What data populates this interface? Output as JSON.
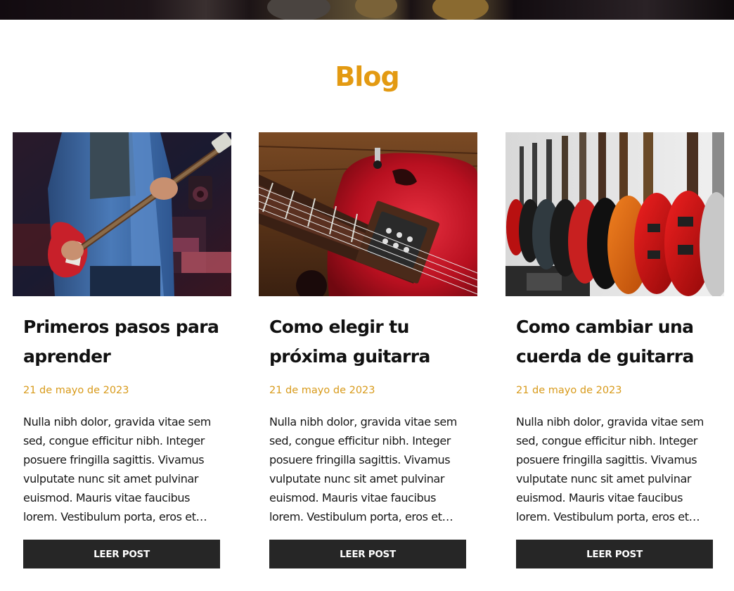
{
  "section": {
    "title": "Blog"
  },
  "posts": [
    {
      "title": "Primeros pasos para aprender",
      "date": "21 de mayo de 2023",
      "excerpt": "Nulla nibh dolor, gravida vitae sem sed, congue efficitur nibh. Integer posuere fringilla sagittis. Vivamus vulputate nunc sit amet pulvinar euismod. Mauris vitae faucibus lorem. Vestibulum porta, eros et…",
      "button_label": "LEER POST",
      "image_alt": "guitarist-playing-red-electric-guitar"
    },
    {
      "title": "Como elegir tu próxima guitarra",
      "date": "21 de mayo de 2023",
      "excerpt": "Nulla nibh dolor, gravida vitae sem sed, congue efficitur nibh. Integer posuere fringilla sagittis. Vivamus vulputate nunc sit amet pulvinar euismod. Mauris vitae faucibus lorem. Vestibulum porta, eros et…",
      "button_label": "LEER POST",
      "image_alt": "red-guitar-body-on-wood"
    },
    {
      "title": "Como cambiar una cuerda de guitarra",
      "date": "21 de mayo de 2023",
      "excerpt": "Nulla nibh dolor, gravida vitae sem sed, congue efficitur nibh. Integer posuere fringilla sagittis. Vivamus vulputate nunc sit amet pulvinar euismod. Mauris vitae faucibus lorem. Vestibulum porta, eros et…",
      "button_label": "LEER POST",
      "image_alt": "guitars-hanging-in-store"
    }
  ],
  "colors": {
    "accent": "#e39a12",
    "date": "#d89a1a",
    "button_bg": "#262626",
    "text": "#111111"
  }
}
